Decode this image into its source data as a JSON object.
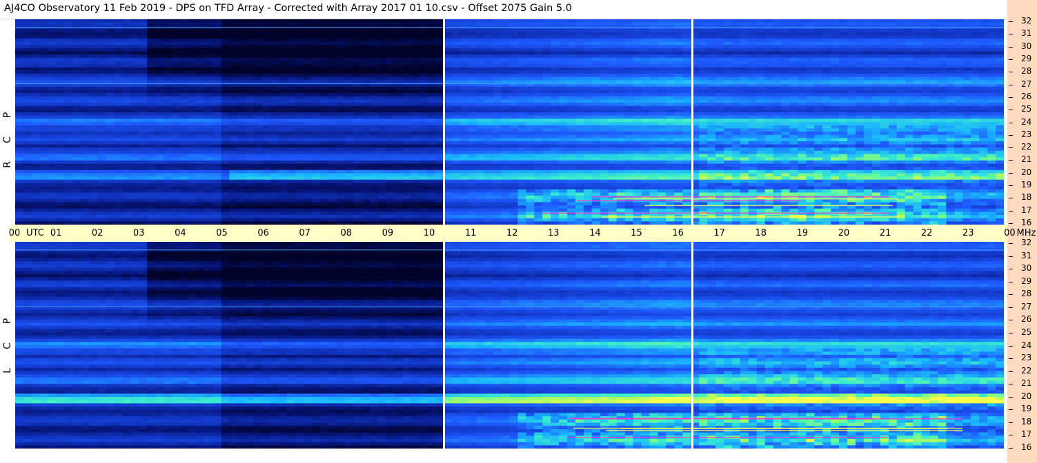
{
  "window": {
    "title": "AJ4CO Observatory  11 Feb 2019  -  DPS on TFD Array  -  Corrected with Array 2017 01 10.csv  -  Offset 2075  Gain 5.0"
  },
  "panels": [
    {
      "name": "rcp",
      "label_letters": [
        "P",
        "C",
        "R"
      ]
    },
    {
      "name": "lcp",
      "label_letters": [
        "P",
        "C",
        "L"
      ]
    }
  ],
  "utc_axis": {
    "unit": "UTC",
    "hours": [
      "00",
      "01",
      "02",
      "03",
      "04",
      "05",
      "06",
      "07",
      "08",
      "09",
      "10",
      "11",
      "12",
      "13",
      "14",
      "15",
      "16",
      "17",
      "18",
      "19",
      "20",
      "21",
      "22",
      "23"
    ],
    "end_label": "00",
    "freq_unit": "MHz"
  },
  "freq_axis": {
    "ticks": [
      "32",
      "31",
      "30",
      "29",
      "28",
      "27",
      "26",
      "25",
      "24",
      "23",
      "22",
      "21",
      "20",
      "19",
      "18",
      "17",
      "16"
    ]
  },
  "colors": {
    "background_dark": "#050a3a",
    "band_blue": "#1f5bff",
    "band_cyan": "#19b5ff",
    "band_green": "#9cff6a",
    "band_yellow": "#ffff4a",
    "hot_magenta": "#ff30c8",
    "utc_bar": "#ffffc8",
    "right_strip": "#fcd9bf"
  },
  "chart_data": {
    "type": "heatmap",
    "title": "AJ4CO Observatory  11 Feb 2019  -  DPS on TFD Array  -  Corrected with Array 2017 01 10.csv  -  Offset 2075  Gain 5.0",
    "xlabel": "UTC",
    "ylabel": "MHz",
    "x_range": [
      0,
      24
    ],
    "y_range": [
      16,
      32
    ],
    "panels": [
      "RCP",
      "LCP"
    ],
    "marker_times_utc": [
      10.4,
      16.4
    ]
  }
}
